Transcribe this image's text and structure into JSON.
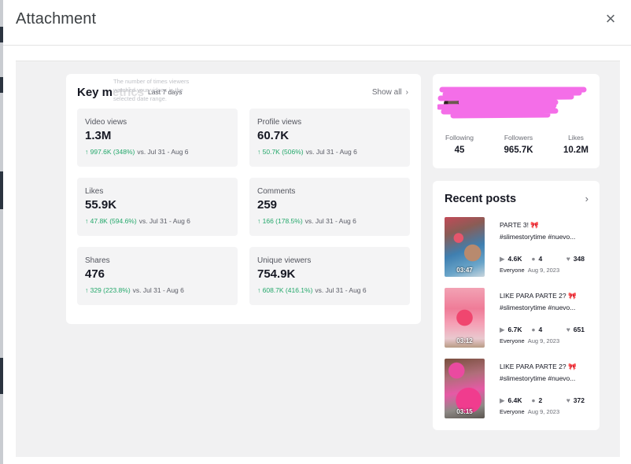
{
  "modal": {
    "title": "Attachment",
    "close_icon": "×"
  },
  "key_metrics": {
    "title": "Key metrics",
    "tooltip": [
      "The number of times viewers",
      "watched your videos in the",
      "selected date range."
    ],
    "range": "Last 7 days",
    "show_all": "Show all",
    "show_all_icon": "›",
    "metrics": [
      {
        "label": "Video views",
        "value": "1.3M",
        "delta": "997.6K (348%)",
        "compare": "vs. Jul 31 - Aug 6"
      },
      {
        "label": "Profile views",
        "value": "60.7K",
        "delta": "50.7K (506%)",
        "compare": "vs. Jul 31 - Aug 6"
      },
      {
        "label": "Likes",
        "value": "55.9K",
        "delta": "47.8K (594.6%)",
        "compare": "vs. Jul 31 - Aug 6"
      },
      {
        "label": "Comments",
        "value": "259",
        "delta": "166 (178.5%)",
        "compare": "vs. Jul 31 - Aug 6"
      },
      {
        "label": "Shares",
        "value": "476",
        "delta": "329 (223.8%)",
        "compare": "vs. Jul 31 - Aug 6"
      },
      {
        "label": "Unique viewers",
        "value": "754.9K",
        "delta": "608.7K (416.1%)",
        "compare": "vs. Jul 31 - Aug 6"
      }
    ],
    "up_icon": "↑"
  },
  "profile": {
    "stats": [
      {
        "label": "Following",
        "value": "45"
      },
      {
        "label": "Followers",
        "value": "965.7K"
      },
      {
        "label": "Likes",
        "value": "10.2M"
      }
    ],
    "redaction_color": "#f46ee8"
  },
  "recent_posts": {
    "title": "Recent posts",
    "arrow": "›",
    "posts": [
      {
        "title": "PARTE 3!",
        "bow": "🎀",
        "tags": "#slimestorytime #nuevo...",
        "duration": "03:47",
        "views": "4.6K",
        "comments": "4",
        "likes": "348",
        "audience": "Everyone",
        "date": "Aug 9, 2023"
      },
      {
        "title": "LIKE PARA PARTE 2?",
        "bow": "🎀",
        "tags": "#slimestorytime #nuevo...",
        "duration": "03:12",
        "views": "6.7K",
        "comments": "4",
        "likes": "651",
        "audience": "Everyone",
        "date": "Aug 9, 2023"
      },
      {
        "title": "LIKE PARA PARTE 2?",
        "bow": "🎀",
        "tags": "#slimestorytime #nuevo...",
        "duration": "03:15",
        "views": "6.4K",
        "comments": "2",
        "likes": "372",
        "audience": "Everyone",
        "date": "Aug 9, 2023"
      }
    ],
    "icons": {
      "views": "▶",
      "comments": "●",
      "likes": "♥"
    }
  }
}
